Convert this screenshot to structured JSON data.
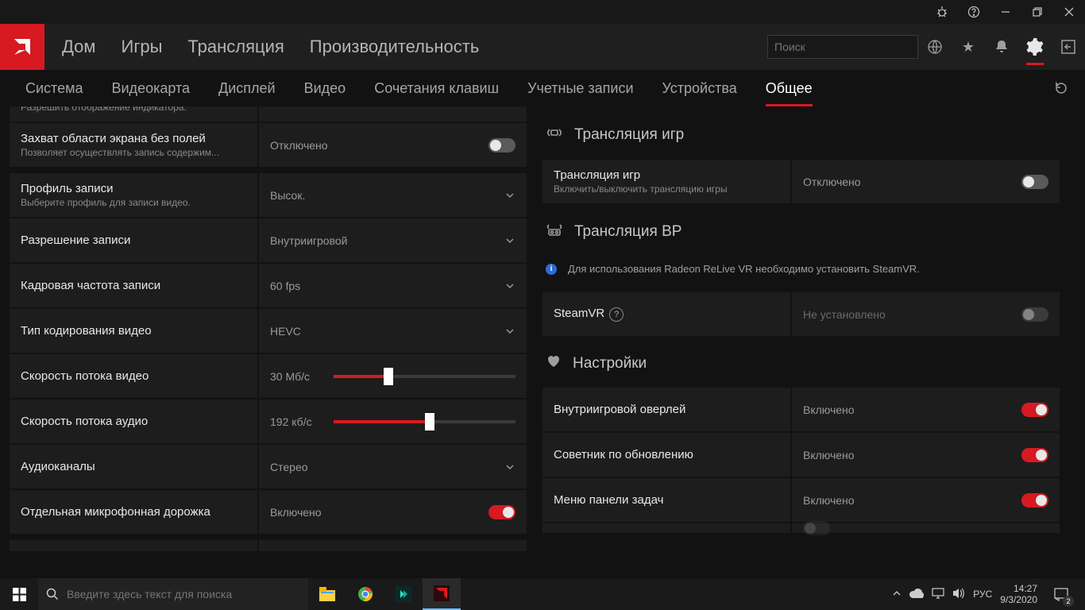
{
  "titlebar": {},
  "main_nav": [
    "Дом",
    "Игры",
    "Трансляция",
    "Производительность"
  ],
  "search_placeholder": "Поиск",
  "sub_nav": {
    "items": [
      "Система",
      "Видеокарта",
      "Дисплей",
      "Видео",
      "Сочетания клавиш",
      "Учетные записи",
      "Устройства",
      "Общее"
    ],
    "active_index": 7
  },
  "left": {
    "top_cut": {
      "title": "",
      "sub": "Разрешить отображение индикатора."
    },
    "capture": {
      "title": "Захват области экрана без полей",
      "sub": "Позволяет осуществлять запись содержим...",
      "value": "Отключено",
      "on": false
    },
    "profile": {
      "title": "Профиль записи",
      "sub": "Выберите профиль для записи видео.",
      "value": "Высок."
    },
    "resolution": {
      "title": "Разрешение записи",
      "value": "Внутриигровой"
    },
    "fps": {
      "title": "Кадровая частота записи",
      "value": "60 fps"
    },
    "codec": {
      "title": "Тип кодирования видео",
      "value": "HEVC"
    },
    "vbitrate": {
      "title": "Скорость потока видео",
      "value": "30 Мб/с",
      "percent": 30
    },
    "abitrate": {
      "title": "Скорость потока аудио",
      "value": "192 кб/с",
      "percent": 53
    },
    "channels": {
      "title": "Аудиоканалы",
      "value": "Стерео"
    },
    "mictrack": {
      "title": "Отдельная микрофонная дорожка",
      "value": "Включено",
      "on": true
    }
  },
  "right": {
    "section1": "Трансляция игр",
    "game_stream": {
      "title": "Трансляция игр",
      "sub": "Включить/выключить трансляцию игры",
      "value": "Отключено",
      "on": false
    },
    "section2": "Трансляция ВР",
    "vr_info": "Для использования Radeon ReLive VR необходимо установить SteamVR.",
    "steamvr": {
      "title": "SteamVR",
      "value": "Не установлено",
      "on": false
    },
    "section3": "Настройки",
    "overlay": {
      "title": "Внутриигровой оверлей",
      "value": "Включено",
      "on": true
    },
    "advisor": {
      "title": "Советник по обновлению",
      "value": "Включено",
      "on": true
    },
    "traymenu": {
      "title": "Меню панели задач",
      "value": "Включено",
      "on": true
    }
  },
  "taskbar": {
    "search_placeholder": "Введите здесь текст для поиска",
    "lang": "РУС",
    "time": "14:27",
    "date": "9/3/2020",
    "notifications": "2"
  },
  "colors": {
    "accent": "#d71921"
  }
}
